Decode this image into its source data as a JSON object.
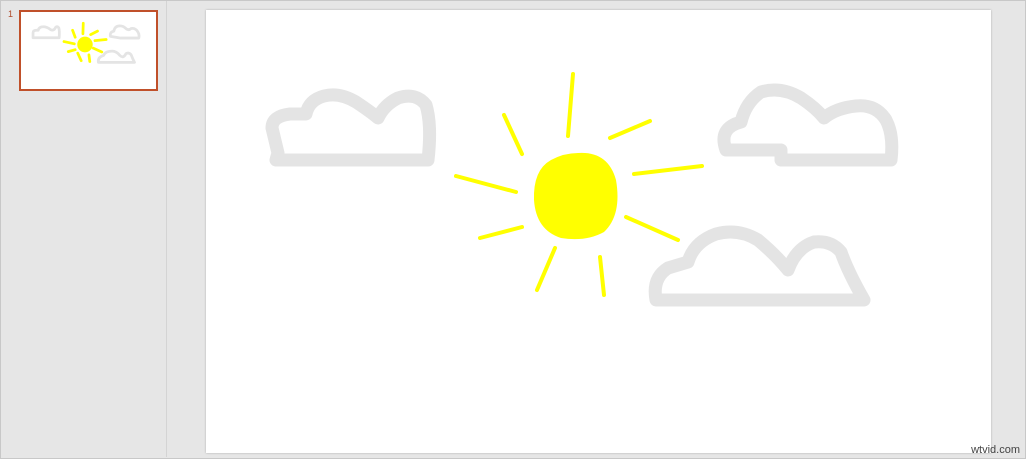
{
  "thumbnail_pane": {
    "slide_number": "1"
  },
  "colors": {
    "sun": "#ffff00",
    "cloud": "#e4e4e4",
    "selection": "#c0502a"
  },
  "watermark": "wtvid.com"
}
